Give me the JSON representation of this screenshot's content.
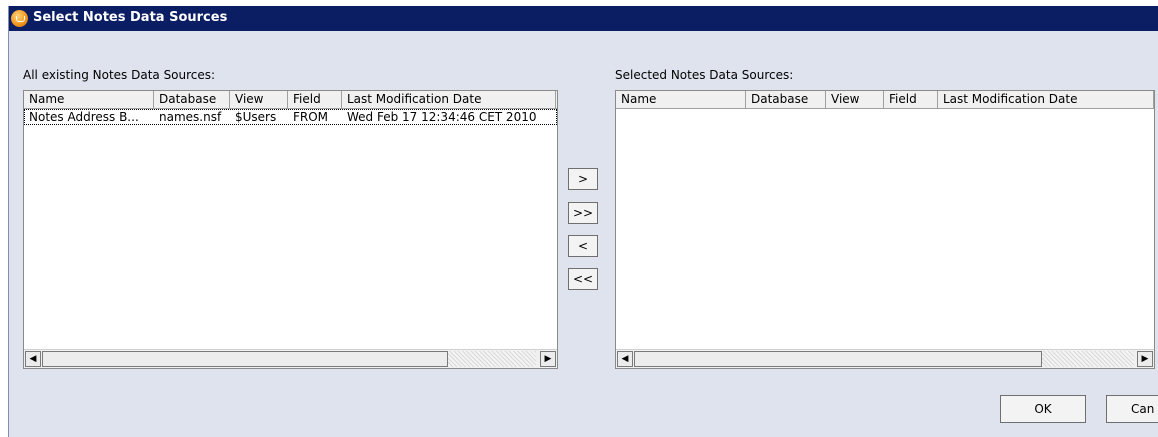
{
  "window": {
    "title": "Select Notes Data Sources"
  },
  "left_panel": {
    "caption": "All existing Notes Data Sources:",
    "columns": [
      "Name",
      "Database",
      "View",
      "Field",
      "Last Modification Date"
    ],
    "rows": [
      {
        "name": "Notes Address B...",
        "database": "names.nsf",
        "view": "$Users",
        "field": "FROM",
        "date": "Wed Feb 17 12:34:46 CET 2010"
      }
    ]
  },
  "right_panel": {
    "caption": "Selected Notes Data Sources:",
    "columns": [
      "Name",
      "Database",
      "View",
      "Field",
      "Last Modification Date"
    ],
    "rows": []
  },
  "move_buttons": {
    "add": ">",
    "add_all": ">>",
    "remove": "<",
    "remove_all": "<<"
  },
  "dialog_buttons": {
    "ok": "OK",
    "cancel": "Can"
  },
  "scrollbar": {
    "left_arrow": "◀",
    "right_arrow": "▶"
  },
  "colors": {
    "title_bar": "#0b1d63",
    "dialog_bg": "#dfe3ee"
  }
}
